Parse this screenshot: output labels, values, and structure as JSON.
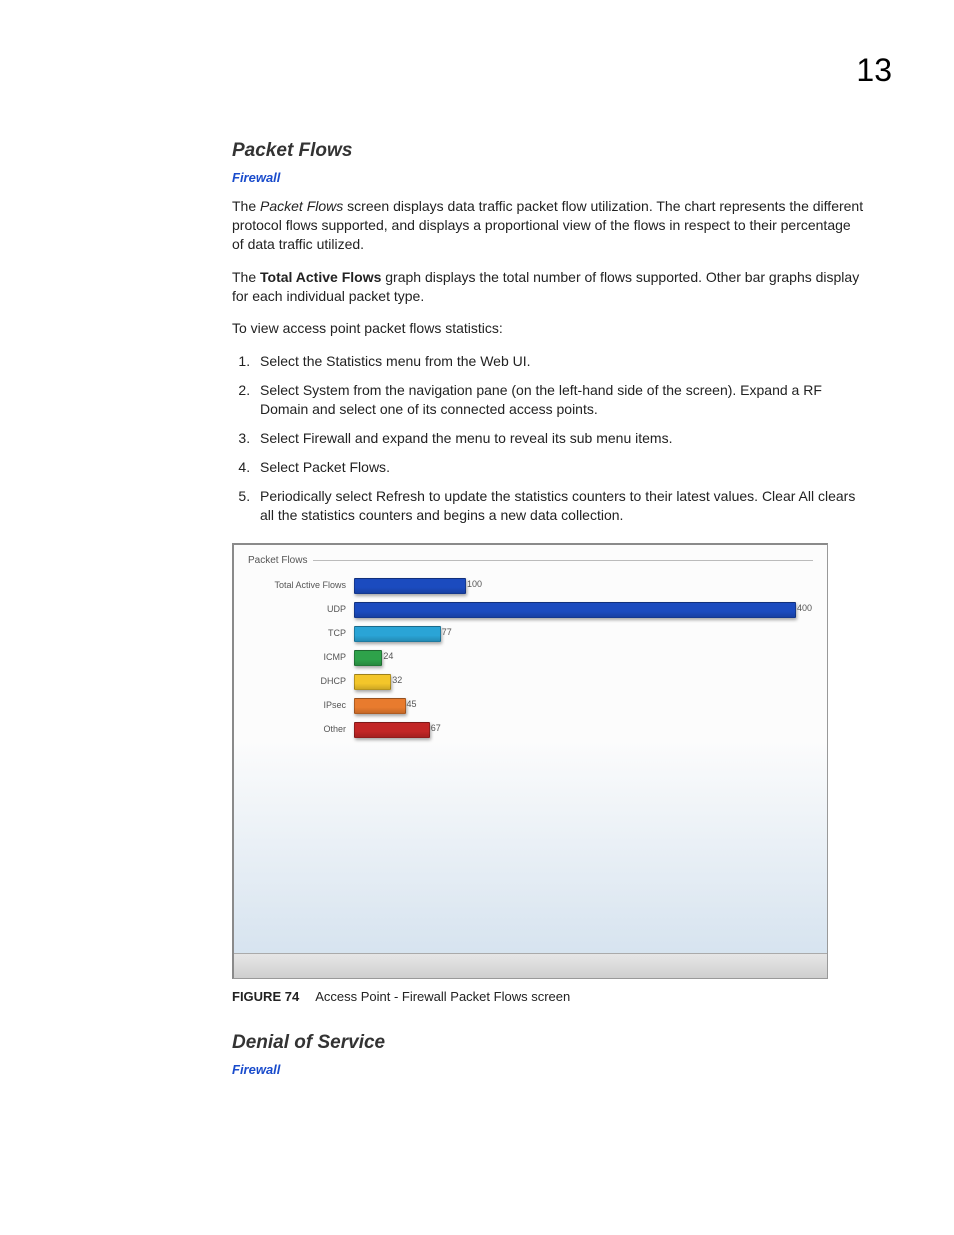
{
  "chapter_number": "13",
  "section1": {
    "heading": "Packet Flows",
    "sublink": "Firewall",
    "para1_a": "The ",
    "para1_em": "Packet Flows",
    "para1_b": " screen displays data traffic packet flow utilization. The chart represents the different protocol flows supported, and displays a proportional view of the flows in respect to their percentage of data traffic utilized.",
    "para2_a": "The ",
    "para2_bold": "Total Active Flows",
    "para2_b": " graph displays the total number of flows supported. Other bar graphs display for each individual packet type.",
    "para3": "To view access point packet flows statistics:",
    "steps": {
      "s1_a": "Select the ",
      "s1_bold": "Statistics",
      "s1_b": " menu from the Web UI.",
      "s2_a": "Select ",
      "s2_bold": "System",
      "s2_b": " from the navigation pane (on the left-hand side of the screen). Expand a RF Domain and select one of its connected access points.",
      "s3_a": "Select ",
      "s3_bold": "Firewall",
      "s3_b": " and expand the menu to reveal its sub menu items.",
      "s4_a": "Select ",
      "s4_bold": "Packet Flows",
      "s4_b": ".",
      "s5_a": "Periodically select ",
      "s5_bold1": "Refresh",
      "s5_b": " to update the statistics counters to their latest values. ",
      "s5_bold2": "Clear All",
      "s5_c": " clears all the statistics counters and begins a new data collection."
    }
  },
  "figure": {
    "group_title": "Packet Flows",
    "caption_label": "FIGURE 74",
    "caption_text": "Access Point - Firewall Packet Flows screen"
  },
  "section2": {
    "heading": "Denial of Service",
    "sublink": "Firewall"
  },
  "chart_data": {
    "type": "bar",
    "orientation": "horizontal",
    "title": "Packet Flows",
    "xlabel": "",
    "ylabel": "",
    "max_scale": 400,
    "categories": [
      "Total Active Flows",
      "UDP",
      "TCP",
      "ICMP",
      "DHCP",
      "IPsec",
      "Other"
    ],
    "values": [
      100,
      400,
      77,
      24,
      32,
      45,
      67
    ],
    "colors": [
      "#1b4bbf",
      "#1b4bbf",
      "#2aa4d6",
      "#2ea24a",
      "#f3c62a",
      "#e87b2e",
      "#c22626"
    ]
  }
}
